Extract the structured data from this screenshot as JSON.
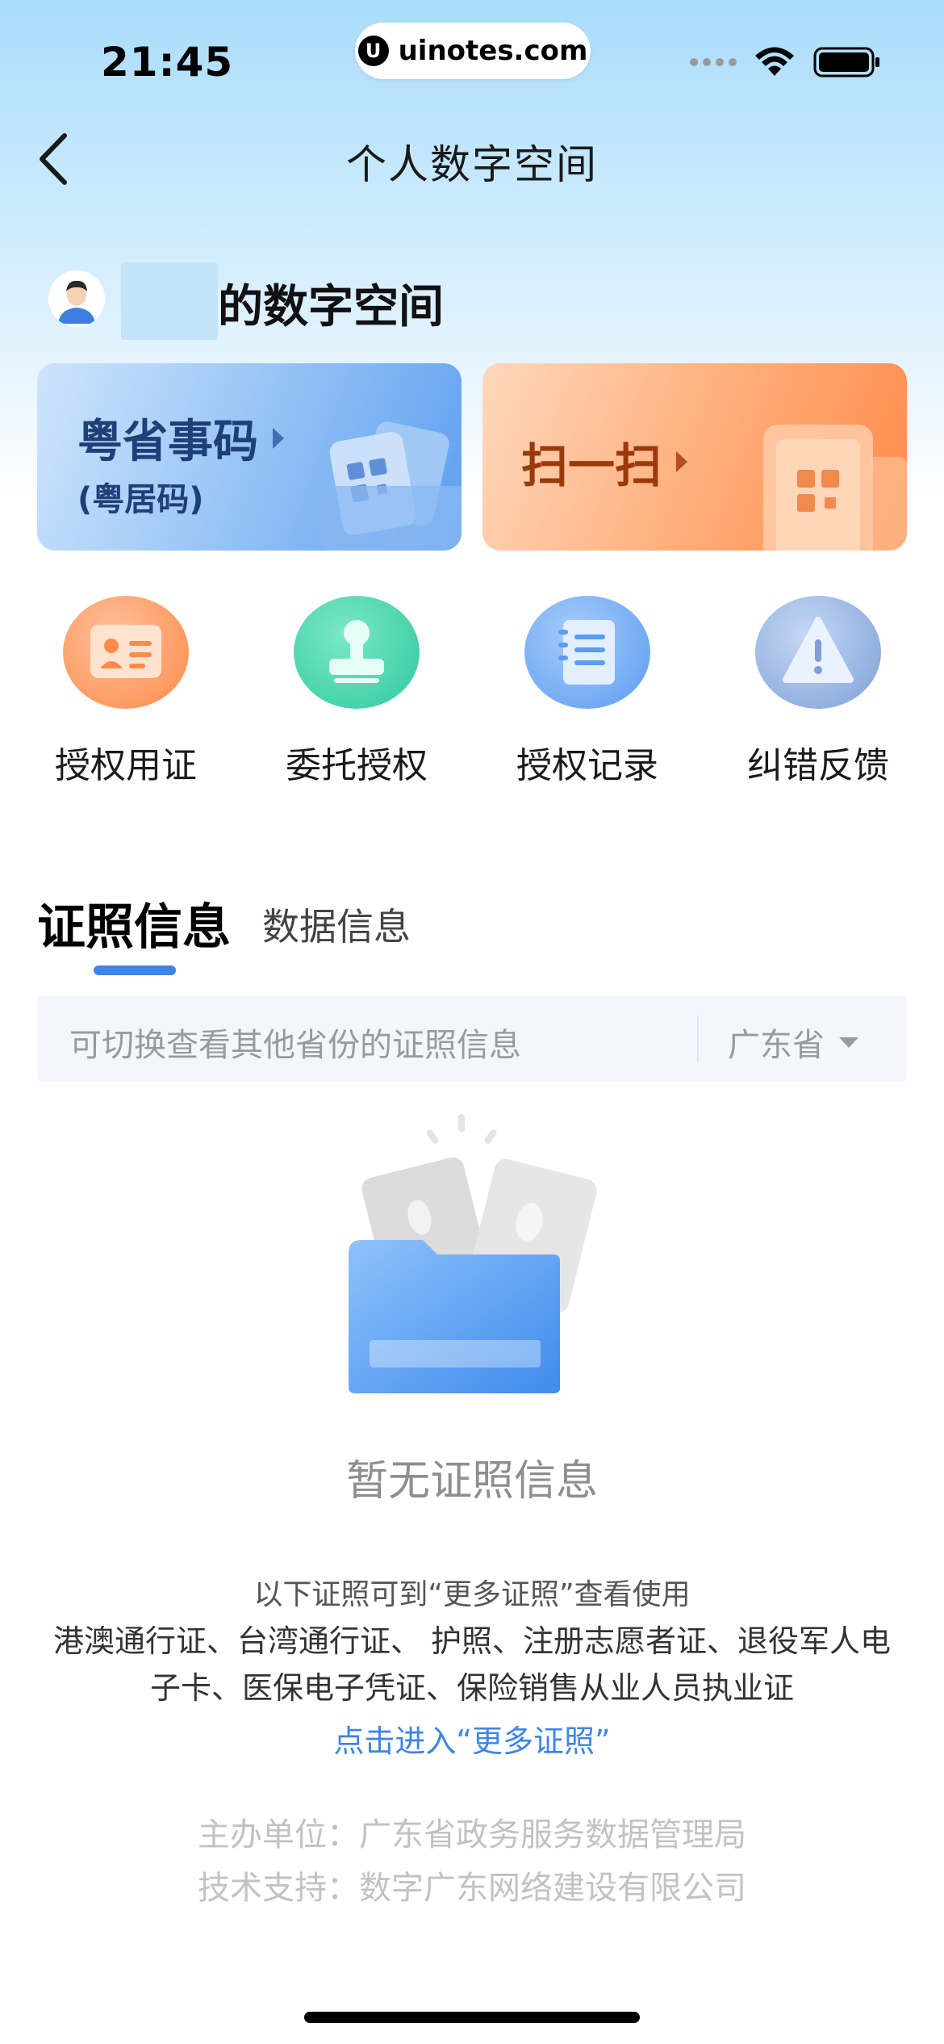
{
  "status_bar": {
    "time": "21:45",
    "url": "uinotes.com",
    "url_logo": "U"
  },
  "nav": {
    "title": "个人数字空间",
    "back_icon": "chevron-left-icon"
  },
  "user": {
    "space_title": "的数字空间"
  },
  "cards": {
    "code": {
      "title": "粤省事码",
      "subtitle": "(粤居码)"
    },
    "scan": {
      "title": "扫一扫"
    }
  },
  "quick_actions": [
    {
      "label": "授权用证",
      "icon": "id-card-icon",
      "color": "#ff8a4a"
    },
    {
      "label": "委托授权",
      "icon": "stamp-icon",
      "color": "#2ec9a0"
    },
    {
      "label": "授权记录",
      "icon": "notebook-icon",
      "color": "#5a9cf0"
    },
    {
      "label": "纠错反馈",
      "icon": "warning-icon",
      "color": "#7f9fd6"
    }
  ],
  "tabs": {
    "active": "证照信息",
    "inactive": "数据信息"
  },
  "search": {
    "placeholder": "可切换查看其他省份的证照信息",
    "province": "广东省"
  },
  "empty": {
    "title": "暂无证照信息",
    "note": "以下证照可到“更多证照”查看使用",
    "list_line1": "港澳通行证、台湾通行证、 护照、注册志愿者证、退役军人电",
    "list_line2": "子卡、医保电子凭证、保险销售从业人员执业证",
    "link": "点击进入“更多证照”"
  },
  "footer": {
    "sponsor": "主办单位：广东省政务服务数据管理局",
    "support": "技术支持：数字广东网络建设有限公司"
  },
  "colors": {
    "accent": "#3e85e8",
    "text_muted": "#9a9a9a"
  }
}
